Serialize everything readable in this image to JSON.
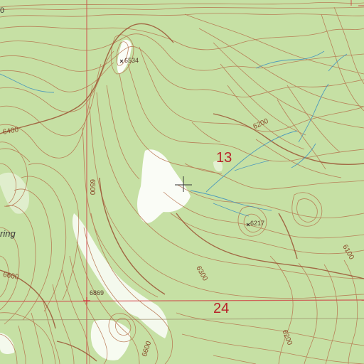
{
  "colors": {
    "background": "#c6e0a4",
    "clearing": "#ffffff",
    "contour": "#b5714b",
    "index_contour": "#9b5434",
    "stream": "#3a8fc0",
    "section_line": "#d0363d",
    "section_text": "#b8222a"
  },
  "contour_labels": {
    "c6400": "6400",
    "c6500": "6500",
    "c6200": "6200",
    "c6300": "6300",
    "c6100": "6100",
    "c6600_left": "6600",
    "c6600_bottom": "6600",
    "c6200_bottom": "6200"
  },
  "spot_elevations": {
    "peak_north": "6534",
    "peak_east": "6217",
    "peak_south": "6869"
  },
  "sections": {
    "north": "13",
    "south": "24"
  },
  "features": {
    "spring_partial": "ring",
    "edge_partial": "0"
  },
  "icons": {
    "feature_marker": "crosshair-icon",
    "spot_elevation_marker": "x-mark-icon",
    "benchmark": "triangle-icon"
  }
}
